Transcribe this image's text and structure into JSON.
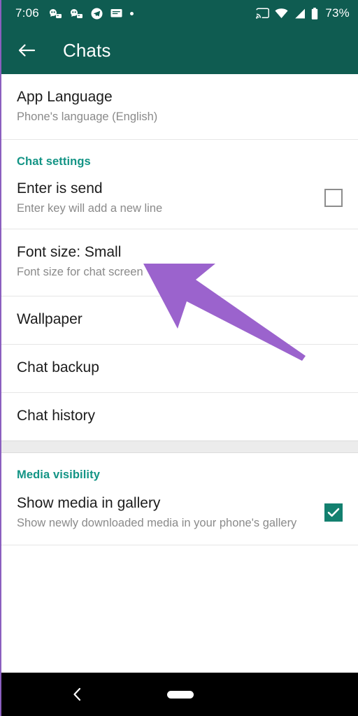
{
  "status_bar": {
    "clock": "7:06",
    "battery_percent": "73%",
    "left_icons": [
      "discord-icon",
      "discord-icon",
      "telegram-icon",
      "message-icon",
      "dot-icon"
    ],
    "right_icons": [
      "cast-icon",
      "wifi-icon",
      "signal-icon",
      "battery-icon"
    ],
    "background_color": "#0F5C51"
  },
  "app_bar": {
    "back_label": "back-arrow",
    "title": "Chats",
    "background_color": "#0F5C51"
  },
  "settings": {
    "app_language": {
      "title": "App Language",
      "subtitle": "Phone's language (English)"
    },
    "chat_settings_header": "Chat settings",
    "enter_is_send": {
      "title": "Enter is send",
      "subtitle": "Enter key will add a new line",
      "checked": false
    },
    "font_size": {
      "title": "Font size: Small",
      "subtitle": "Font size for chat screen"
    },
    "wallpaper": {
      "title": "Wallpaper"
    },
    "chat_backup": {
      "title": "Chat backup"
    },
    "chat_history": {
      "title": "Chat history"
    },
    "media_visibility_header": "Media visibility",
    "show_media_in_gallery": {
      "title": "Show media in gallery",
      "subtitle": "Show newly downloaded media in your phone's gallery",
      "checked": true
    }
  },
  "annotation": {
    "arrow_color": "#9B63CD",
    "points_at": "Font size: Small"
  },
  "nav_bar": {
    "back_label": "nav-back-icon",
    "home_label": "nav-home-pill",
    "background_color": "#000000"
  },
  "colors": {
    "header_teal": "#0F5C51",
    "accent_teal": "#139485",
    "checkbox_on": "#13806f",
    "divider": "#e6e6e6",
    "band": "#ececec"
  }
}
